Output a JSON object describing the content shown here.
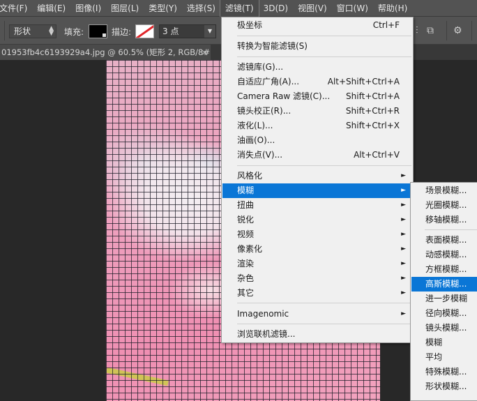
{
  "menubar": {
    "items": [
      {
        "label": "文件(F)"
      },
      {
        "label": "编辑(E)"
      },
      {
        "label": "图像(I)"
      },
      {
        "label": "图层(L)"
      },
      {
        "label": "类型(Y)"
      },
      {
        "label": "选择(S)"
      },
      {
        "label": "滤镜(T)"
      },
      {
        "label": "3D(D)"
      },
      {
        "label": "视图(V)"
      },
      {
        "label": "窗口(W)"
      },
      {
        "label": "帮助(H)"
      }
    ],
    "active_index": 6
  },
  "options": {
    "shape_mode": "形状",
    "fill_label": "填充:",
    "stroke_label": "描边:",
    "stroke_size": "3 点",
    "fill_color": "#000000",
    "stroke_color": "#e0262a"
  },
  "tab": {
    "title": "01953fb4c6193929a4.jpg @ 60.5% (矩形 2, RGB/8#) *",
    "close": "×"
  },
  "filter_menu": {
    "items": [
      {
        "label": "极坐标",
        "shortcut": "Ctrl+F"
      },
      {
        "label": "转换为智能滤镜(S)",
        "shortcut": ""
      },
      {
        "label": "滤镜库(G)...",
        "shortcut": ""
      },
      {
        "label": "自适应广角(A)...",
        "shortcut": "Alt+Shift+Ctrl+A"
      },
      {
        "label": "Camera Raw 滤镜(C)...",
        "shortcut": "Shift+Ctrl+A"
      },
      {
        "label": "镜头校正(R)...",
        "shortcut": "Shift+Ctrl+R"
      },
      {
        "label": "液化(L)...",
        "shortcut": "Shift+Ctrl+X"
      },
      {
        "label": "油画(O)...",
        "shortcut": ""
      },
      {
        "label": "消失点(V)...",
        "shortcut": "Alt+Ctrl+V"
      },
      {
        "label": "风格化",
        "shortcut": ""
      },
      {
        "label": "模糊",
        "shortcut": ""
      },
      {
        "label": "扭曲",
        "shortcut": ""
      },
      {
        "label": "锐化",
        "shortcut": ""
      },
      {
        "label": "视频",
        "shortcut": ""
      },
      {
        "label": "像素化",
        "shortcut": ""
      },
      {
        "label": "渲染",
        "shortcut": ""
      },
      {
        "label": "杂色",
        "shortcut": ""
      },
      {
        "label": "其它",
        "shortcut": ""
      },
      {
        "label": "Imagenomic",
        "shortcut": ""
      },
      {
        "label": "浏览联机滤镜...",
        "shortcut": ""
      }
    ],
    "highlighted": "模糊",
    "accent_color": "#0a76d6"
  },
  "blur_submenu": {
    "items": [
      {
        "label": "场景模糊..."
      },
      {
        "label": "光圈模糊..."
      },
      {
        "label": "移轴模糊..."
      },
      {
        "label": "表面模糊..."
      },
      {
        "label": "动感模糊..."
      },
      {
        "label": "方框模糊..."
      },
      {
        "label": "高斯模糊..."
      },
      {
        "label": "进一步模糊"
      },
      {
        "label": "径向模糊..."
      },
      {
        "label": "镜头模糊..."
      },
      {
        "label": "模糊"
      },
      {
        "label": "平均"
      },
      {
        "label": "特殊模糊..."
      },
      {
        "label": "形状模糊..."
      }
    ],
    "highlighted": "高斯模糊..."
  }
}
